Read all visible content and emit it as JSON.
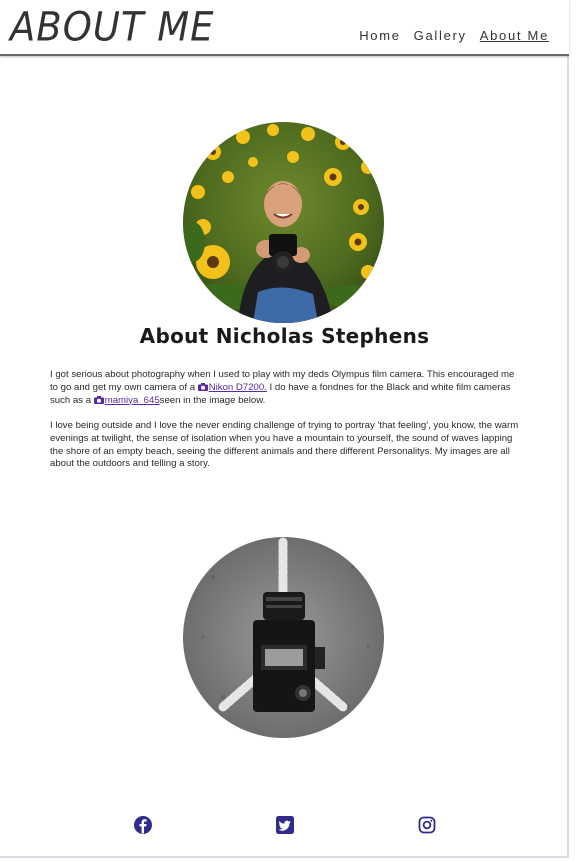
{
  "header": {
    "logo": "ABOUT ME",
    "nav": [
      {
        "label": "Home",
        "active": false
      },
      {
        "label": "Gallery",
        "active": false
      },
      {
        "label": "About Me",
        "active": true
      }
    ]
  },
  "main": {
    "title": "About Nicholas Stephens",
    "paragraph1": {
      "text_before": "I got serious about photography when I used to play with my deds Olympus film camera. This encouraged me to go and get my own camera of a ",
      "link1": "Nikon D7200.",
      "text_middle": " I do have a fondnes for the Black and white film cameras such as a ",
      "link2": "mamiya_645",
      "text_after": "seen in the image below."
    },
    "paragraph2": "I love being outside and I love the never ending challenge of trying to portray 'that feeling', you know, the warm evenings at twilight, the sense of isolation when you have a mountain to yourself, the sound of waves lapping the shore of an empty beach, seeing the different animals and there different Personalitys. My images are all about the outdoors and telling a story."
  },
  "footer": {
    "social": [
      "facebook-icon",
      "twitter-icon",
      "instagram-icon"
    ]
  },
  "colors": {
    "link": "#5a2aa0",
    "social_icon": "#312a8a"
  }
}
